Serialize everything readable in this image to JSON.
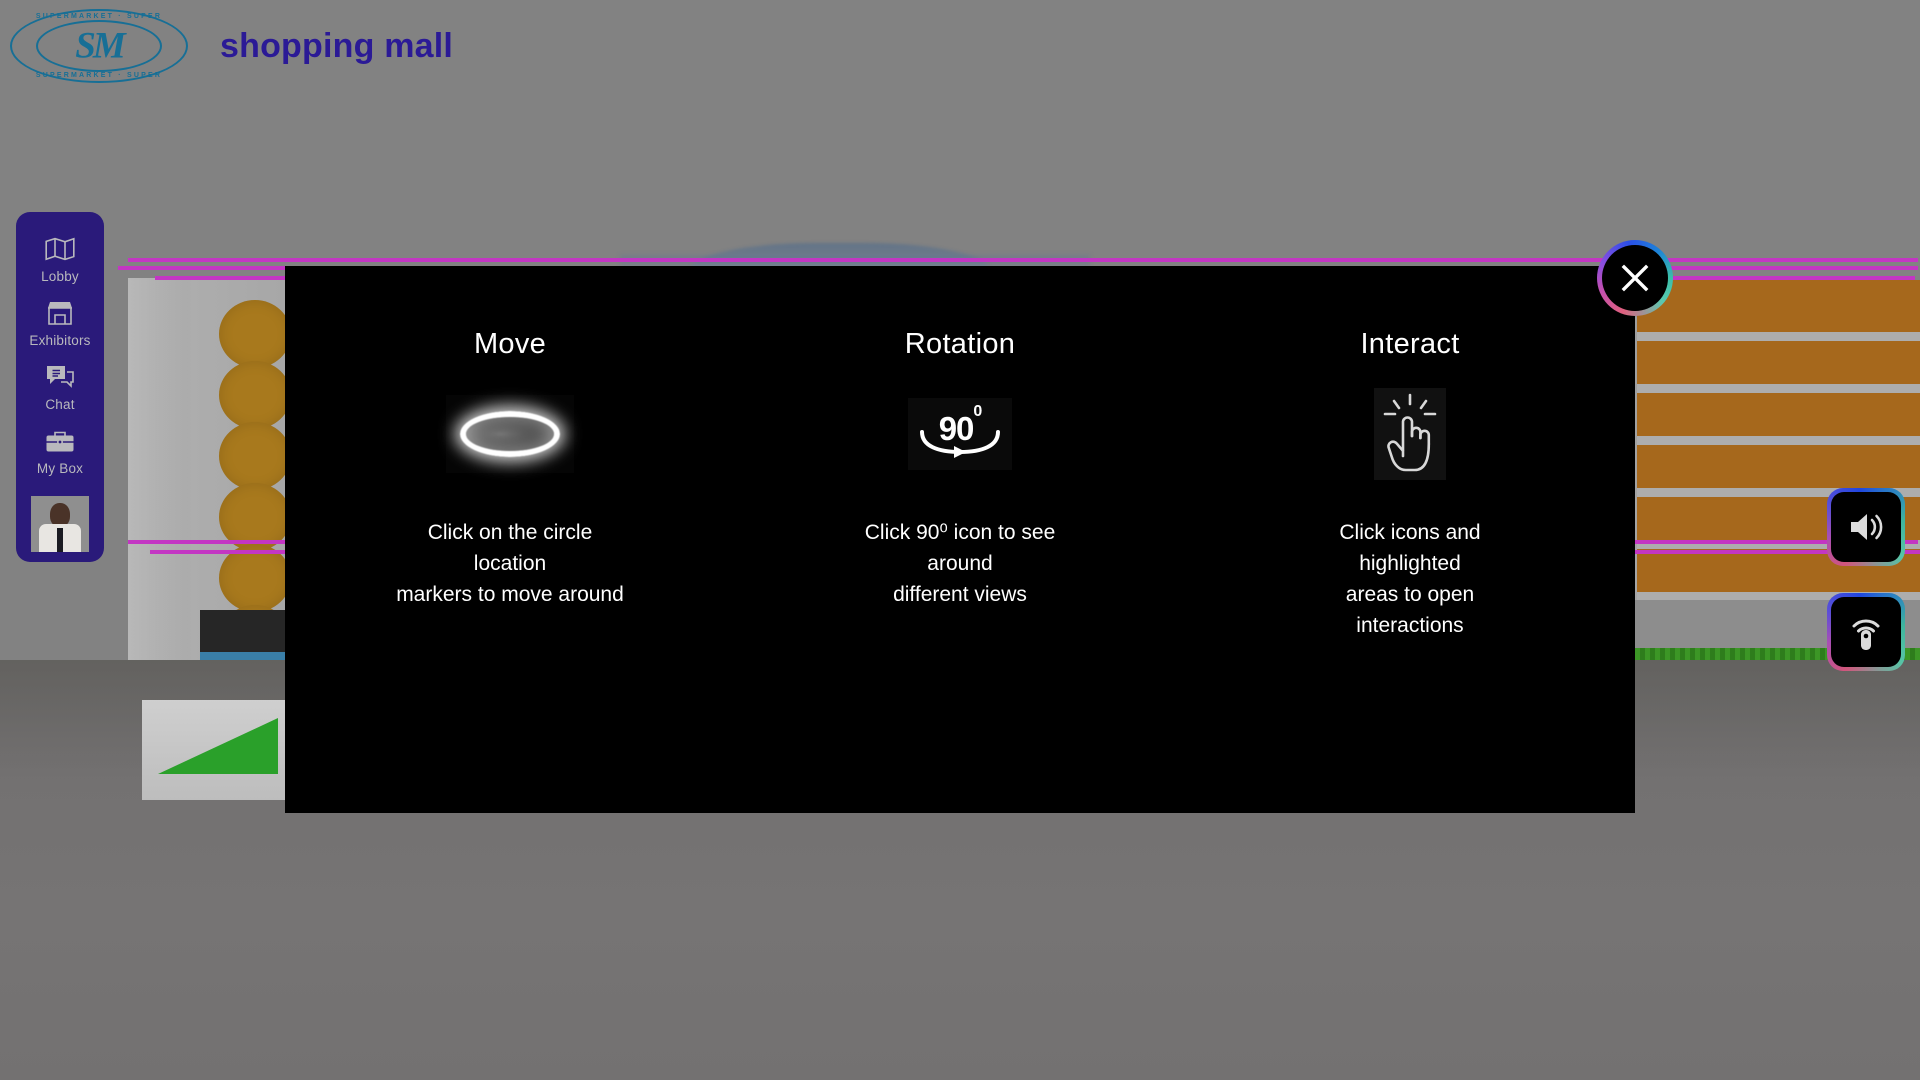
{
  "header": {
    "brand_title": "shopping mall",
    "logo": {
      "icon_name": "sm-supermarket-seal-logo",
      "monogram": "SM",
      "ring_text_top": "SUPERMARKET  ·  SUPER",
      "ring_text_bottom": "SUPERMARKET  ·  SUPER",
      "color": "#176f96"
    },
    "title_color": "#2b1a96"
  },
  "sidebar": {
    "background_color": "#2a1a7a",
    "items": [
      {
        "label": "Lobby",
        "icon": "map-icon"
      },
      {
        "label": "Exhibitors",
        "icon": "store-icon"
      },
      {
        "label": "Chat",
        "icon": "chat-bubbles-icon"
      },
      {
        "label": "My Box",
        "icon": "briefcase-icon"
      }
    ],
    "avatar": {
      "icon": "user-avatar-thumbnail"
    }
  },
  "modal": {
    "background_color": "#000000",
    "close_label": "×",
    "close_icon": "close-x-icon",
    "columns": [
      {
        "title": "Move",
        "icon": "location-marker-ellipse-icon",
        "lines": [
          "Click on the circle",
          "location",
          "markers to move around"
        ]
      },
      {
        "title": "Rotation",
        "icon": "rotate-90-degrees-icon",
        "icon_text": "90",
        "icon_sup": "0",
        "lines": [
          "Click 90⁰ icon to see",
          "around",
          "different views"
        ]
      },
      {
        "title": "Interact",
        "icon": "click-hand-icon",
        "lines": [
          "Click icons and",
          "highlighted",
          "areas to open",
          "interactions"
        ]
      }
    ]
  },
  "side_buttons": [
    {
      "name": "volume-button",
      "icon": "speaker-volume-icon"
    },
    {
      "name": "broadcast-button",
      "icon": "remote-signal-icon"
    }
  ],
  "scene": {
    "background_color": "#808080",
    "floor_color": "#757373",
    "accent_line_color": "#c336c3",
    "left_dots_color": "#a8791d",
    "right_building_color": "#a6681c",
    "grass_color": "#3c9626"
  }
}
